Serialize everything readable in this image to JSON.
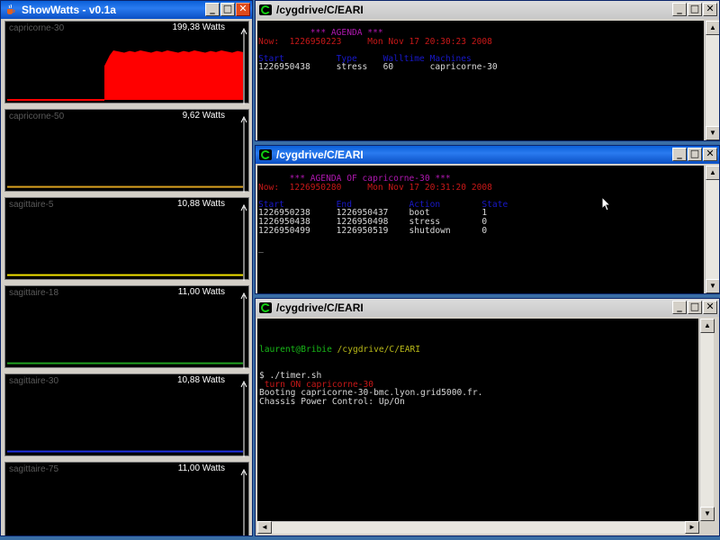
{
  "showwatts": {
    "title": "ShowWatts - v0.1a",
    "panels": [
      {
        "name": "capricorne-30",
        "watts": "199,38 Watts",
        "level": 0.82,
        "color": "#ff0000",
        "fill": true
      },
      {
        "name": "capricorne-50",
        "watts": "9,62 Watts",
        "level": 0.02,
        "color": "#d8a020",
        "fill": false
      },
      {
        "name": "sagittaire-5",
        "watts": "10,88 Watts",
        "level": 0.02,
        "color": "#f0e000",
        "fill": false
      },
      {
        "name": "sagittaire-18",
        "watts": "11,00 Watts",
        "level": 0.02,
        "color": "#20a020",
        "fill": false
      },
      {
        "name": "sagittaire-30",
        "watts": "10,88 Watts",
        "level": 0.02,
        "color": "#2030e0",
        "fill": false
      },
      {
        "name": "sagittaire-75",
        "watts": "11,00 Watts",
        "level": 0.02,
        "color": "#ffffff",
        "fill": false
      }
    ]
  },
  "term1": {
    "title": "/cygdrive/C/EARI",
    "lines": [
      {
        "pre": "          ",
        "text": "*** AGENDA ***",
        "color": "mag"
      },
      {
        "pre": "",
        "text": "Now:  1226950223     Mon Nov 17 20:30:23 2008",
        "color": "red"
      },
      {
        "pre": "",
        "text": "",
        "color": ""
      },
      {
        "pre": "",
        "text": "Start          Type     Walltime Machines",
        "color": "blue"
      },
      {
        "pre": "",
        "text": "1226950438     stress   60       capricorne-30",
        "color": "white"
      }
    ]
  },
  "term2": {
    "title": "/cygdrive/C/EARI",
    "lines": [
      {
        "pre": "      ",
        "text": "*** AGENDA OF capricorne-30 ***",
        "color": "mag"
      },
      {
        "pre": "",
        "text": "Now:  1226950280     Mon Nov 17 20:31:20 2008",
        "color": "red"
      },
      {
        "pre": "",
        "text": "",
        "color": ""
      },
      {
        "pre": "",
        "text": "Start          End           Action        State",
        "color": "blue"
      },
      {
        "pre": "",
        "text": "1226950238     1226950437    boot          1",
        "color": "white"
      },
      {
        "pre": "",
        "text": "1226950438     1226950498    stress        0",
        "color": "white"
      },
      {
        "pre": "",
        "text": "1226950499     1226950519    shutdown      0",
        "color": "white"
      },
      {
        "pre": "",
        "text": "",
        "color": ""
      },
      {
        "pre": "",
        "text": "_",
        "color": "white"
      }
    ]
  },
  "term3": {
    "title": "/cygdrive/C/EARI",
    "prompt_user": "laurent@Bribie",
    "prompt_path": "/cygdrive/C/EARI",
    "lines": [
      {
        "pre": "",
        "text": "$ ./timer.sh",
        "color": "white"
      },
      {
        "pre": " ",
        "text": "turn ON capricorne-30",
        "color": "red"
      },
      {
        "pre": "",
        "text": "Booting capricorne-30-bmc.lyon.grid5000.fr.",
        "color": "white"
      },
      {
        "pre": "",
        "text": "Chassis Power Control: Up/On",
        "color": "white"
      }
    ]
  },
  "buttons": {
    "min": "_",
    "max": "□",
    "close": "✕",
    "up": "▲",
    "down": "▼",
    "left": "◄",
    "right": "►"
  }
}
